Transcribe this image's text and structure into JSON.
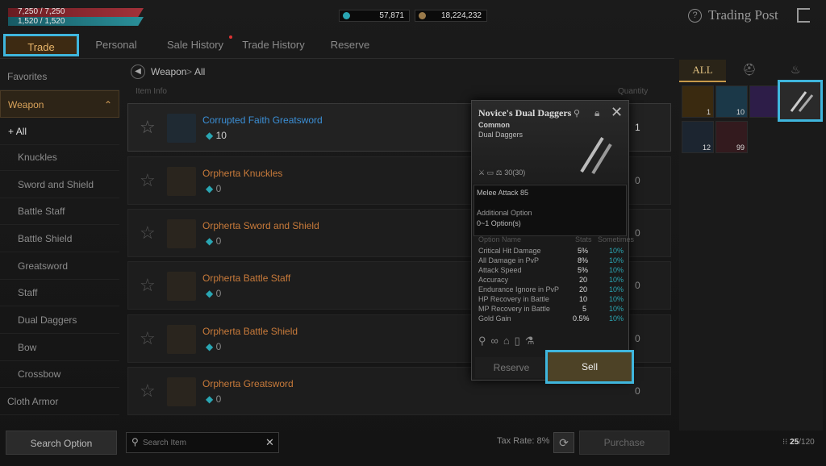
{
  "status": {
    "hp": "7,250 / 7,250",
    "mp": "1,520 / 1,520"
  },
  "currency": {
    "diamonds": "57,871",
    "gold": "18,224,232"
  },
  "header": {
    "title": "Trading Post"
  },
  "tabs": [
    {
      "label": "Trade"
    },
    {
      "label": "Personal"
    },
    {
      "label": "Sale History"
    },
    {
      "label": "Trade History"
    },
    {
      "label": "Reserve"
    }
  ],
  "sidebar": {
    "favorites": "Favorites",
    "weapon": "Weapon",
    "items": [
      "All",
      "Knuckles",
      "Sword and Shield",
      "Battle Staff",
      "Battle Shield",
      "Greatsword",
      "Staff",
      "Dual Daggers",
      "Bow",
      "Crossbow"
    ],
    "cloth_armor": "Cloth Armor",
    "search_option": "Search Option"
  },
  "breadcrumb": {
    "category": "Weapon",
    "sub": "All"
  },
  "list_header": {
    "item_info": "Item Info",
    "quantity": "Quantity"
  },
  "items": [
    {
      "name": "Corrupted Faith Greatsword",
      "price": "10",
      "qty": "1"
    },
    {
      "name": "Orpherta Knuckles",
      "price": "0",
      "qty": "0"
    },
    {
      "name": "Orpherta Sword and Shield",
      "price": "0",
      "qty": "0"
    },
    {
      "name": "Orpherta Battle Staff",
      "price": "0",
      "qty": "0"
    },
    {
      "name": "Orpherta Battle Shield",
      "price": "0",
      "qty": "0"
    },
    {
      "name": "Orpherta Greatsword",
      "price": "0",
      "qty": "0"
    }
  ],
  "popup": {
    "title": "Novice's Dual Daggers",
    "grade": "Common",
    "type": "Dual Daggers",
    "weight": "30(30)",
    "stat": "Melee Attack 85",
    "additional": "Additional Option",
    "options_count": "0~1 Option(s)",
    "col_name": "Option Name",
    "col_stats": "Stats",
    "col_sometimes": "Sometimes",
    "options": [
      {
        "name": "Critical Hit Damage",
        "stat": "5%",
        "chance": "10%"
      },
      {
        "name": "All Damage in PvP",
        "stat": "8%",
        "chance": "10%"
      },
      {
        "name": "Attack Speed",
        "stat": "5%",
        "chance": "10%"
      },
      {
        "name": "Accuracy",
        "stat": "20",
        "chance": "10%"
      },
      {
        "name": "Endurance Ignore in PvP",
        "stat": "20",
        "chance": "10%"
      },
      {
        "name": "HP Recovery in Battle",
        "stat": "10",
        "chance": "10%"
      },
      {
        "name": "MP Recovery in Battle",
        "stat": "5",
        "chance": "10%"
      },
      {
        "name": "Gold Gain",
        "stat": "0.5%",
        "chance": "10%"
      }
    ],
    "reserve": "Reserve",
    "sell": "Sell"
  },
  "inventory": {
    "tab_all": "ALL",
    "counts": [
      "1",
      "10",
      "",
      "",
      "12",
      "99"
    ],
    "capacity": "25",
    "capacity_max": "/120"
  },
  "bottom": {
    "search_placeholder": "Search Item",
    "tax_rate": "Tax Rate: 8%",
    "purchase": "Purchase"
  },
  "colors": {
    "accent": "#3fb6dd",
    "orange": "#c87a3a",
    "blue_item": "#3b8fd6"
  }
}
